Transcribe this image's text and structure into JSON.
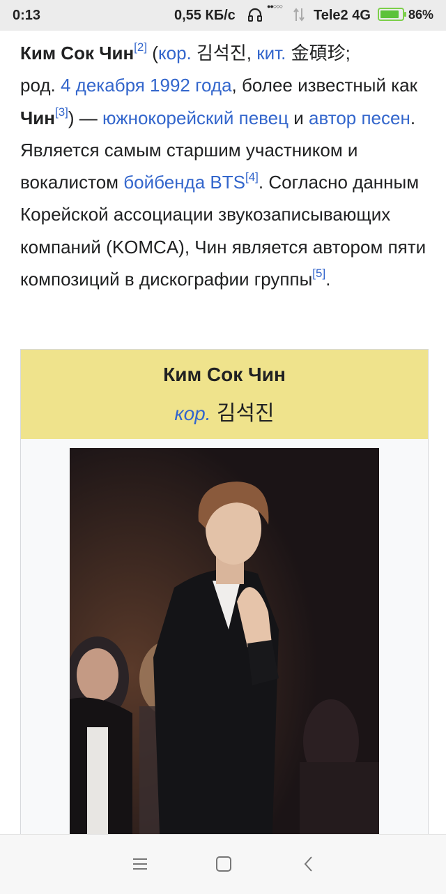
{
  "status_bar": {
    "time": "0:13",
    "network_speed": "0,55 КБ/с",
    "carrier": "Tele2 4G",
    "battery_percent": "86%",
    "battery_level": 0.86
  },
  "article": {
    "subject_name": "Ким Сок Чин",
    "ref_2": "[2]",
    "paren_open": " (",
    "kor_abbr": "кор.",
    "korean_name": " 김석진",
    "comma1": ", ",
    "chinese_abbr": "кит.",
    "chinese_name": " 金碩珍;",
    "born_prefix": "род. ",
    "birth_date_link": "4 декабря 1992 года",
    "known_as": ", более известный как ",
    "stage_name": "Чин",
    "ref_3": "[3]",
    "dash": ") — ",
    "singer_link": "южнокорейский певец",
    "and": " и ",
    "songwriter_link": "автор песен",
    "sentence2": ". Является самым старшим участником и вокалистом ",
    "boyband_link": "бойбенда BTS",
    "ref_4": "[4]",
    "sentence3": ". Согласно данным Корейской ассоциации звукозаписывающих компаний (KOMCA), Чин является автором пяти композиций в дискографии группы",
    "ref_5": "[5]",
    "period": "."
  },
  "infobox": {
    "title": "Ким Сок Чин",
    "native_abbr": "кор.",
    "native_name": " 김석진"
  },
  "colors": {
    "link": "#3366cc",
    "infobox_header": "#efe38c",
    "battery": "#5cc23a"
  }
}
